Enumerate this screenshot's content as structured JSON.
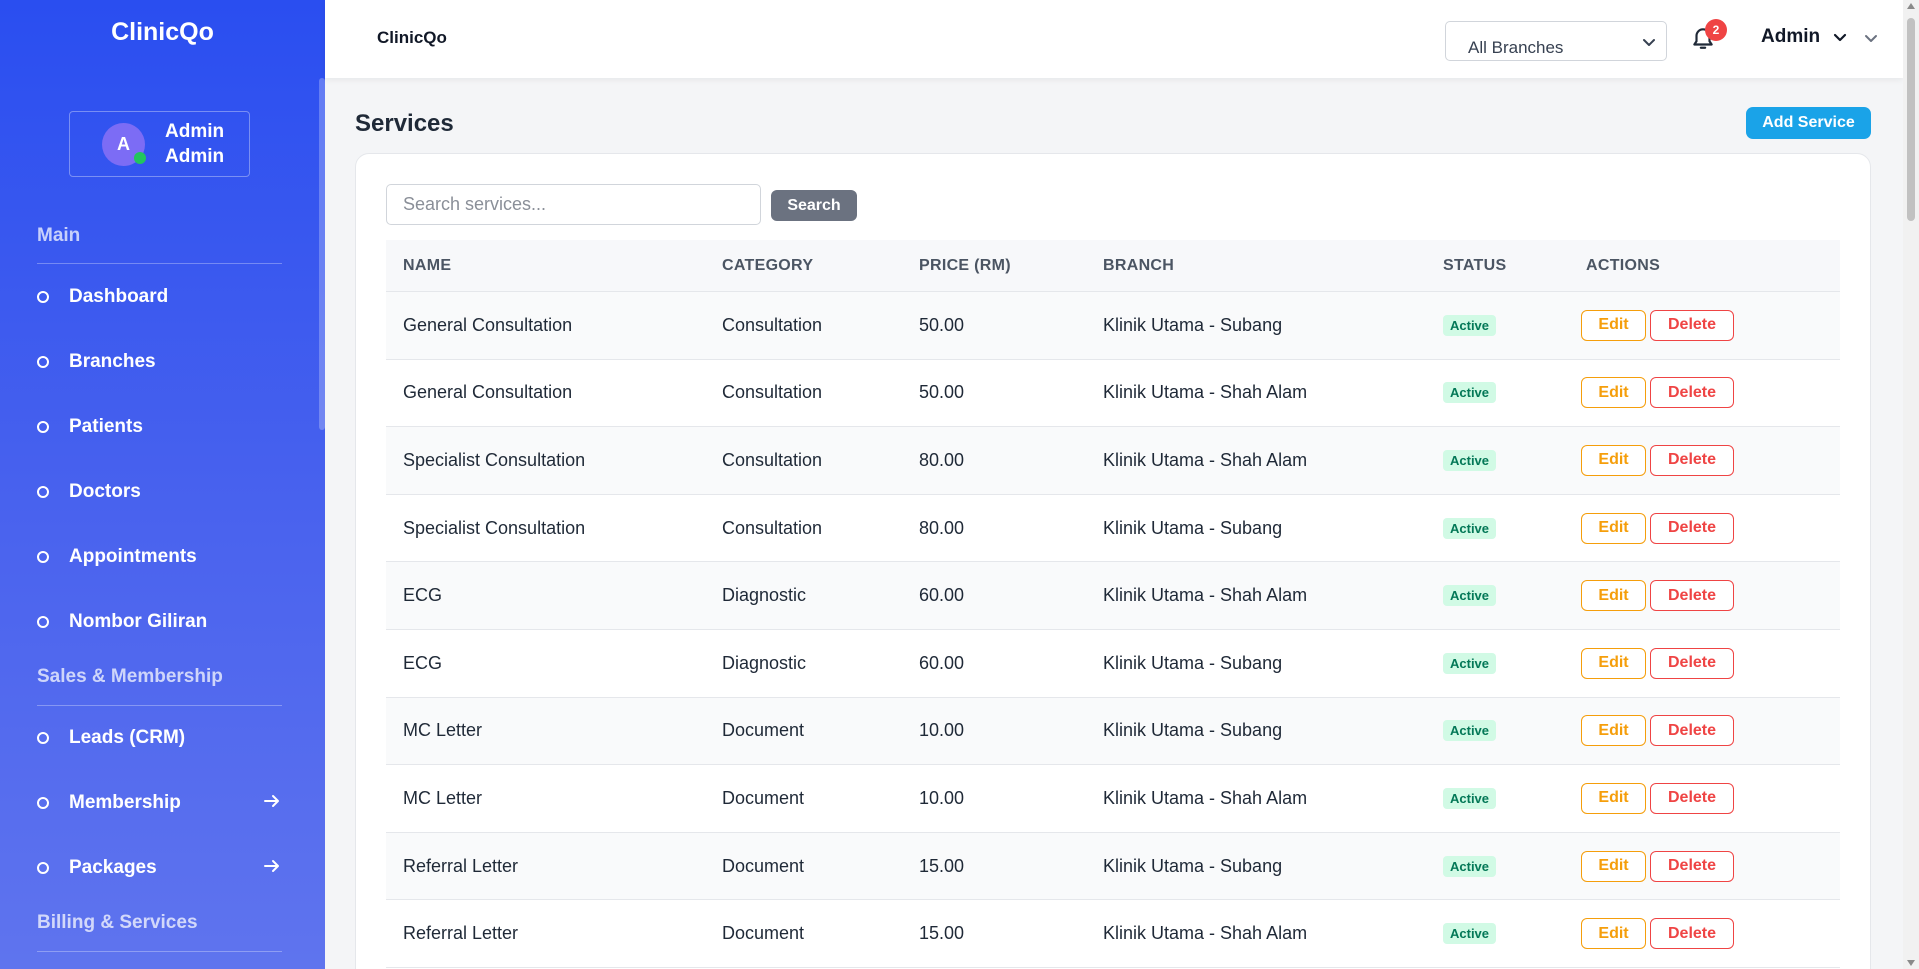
{
  "sidebar": {
    "brand": "ClinicQo",
    "user": {
      "initial": "A",
      "name": "Admin",
      "role": "Admin"
    },
    "sections": {
      "main": "Main",
      "sales": "Sales & Membership",
      "billing": "Billing & Services"
    },
    "items": [
      {
        "label": "Dashboard"
      },
      {
        "label": "Branches"
      },
      {
        "label": "Patients"
      },
      {
        "label": "Doctors"
      },
      {
        "label": "Appointments"
      },
      {
        "label": "Nombor Giliran"
      },
      {
        "label": "Leads (CRM)"
      },
      {
        "label": "Membership"
      },
      {
        "label": "Packages"
      }
    ]
  },
  "topbar": {
    "title": "ClinicQo",
    "branch_select": "All Branches",
    "notification_count": "2",
    "user_menu": "Admin"
  },
  "page": {
    "title": "Services",
    "add_button": "Add Service",
    "search_placeholder": "Search services...",
    "search_button": "Search"
  },
  "table": {
    "columns": [
      "NAME",
      "CATEGORY",
      "PRICE (RM)",
      "BRANCH",
      "STATUS",
      "ACTIONS"
    ],
    "edit_label": "Edit",
    "delete_label": "Delete",
    "rows": [
      {
        "name": "General Consultation",
        "category": "Consultation",
        "price": "50.00",
        "branch": "Klinik Utama - Subang",
        "status": "Active"
      },
      {
        "name": "General Consultation",
        "category": "Consultation",
        "price": "50.00",
        "branch": "Klinik Utama - Shah Alam",
        "status": "Active"
      },
      {
        "name": "Specialist Consultation",
        "category": "Consultation",
        "price": "80.00",
        "branch": "Klinik Utama - Shah Alam",
        "status": "Active"
      },
      {
        "name": "Specialist Consultation",
        "category": "Consultation",
        "price": "80.00",
        "branch": "Klinik Utama - Subang",
        "status": "Active"
      },
      {
        "name": "ECG",
        "category": "Diagnostic",
        "price": "60.00",
        "branch": "Klinik Utama - Shah Alam",
        "status": "Active"
      },
      {
        "name": "ECG",
        "category": "Diagnostic",
        "price": "60.00",
        "branch": "Klinik Utama - Subang",
        "status": "Active"
      },
      {
        "name": "MC Letter",
        "category": "Document",
        "price": "10.00",
        "branch": "Klinik Utama - Subang",
        "status": "Active"
      },
      {
        "name": "MC Letter",
        "category": "Document",
        "price": "10.00",
        "branch": "Klinik Utama - Shah Alam",
        "status": "Active"
      },
      {
        "name": "Referral Letter",
        "category": "Document",
        "price": "15.00",
        "branch": "Klinik Utama - Subang",
        "status": "Active"
      },
      {
        "name": "Referral Letter",
        "category": "Document",
        "price": "15.00",
        "branch": "Klinik Utama - Shah Alam",
        "status": "Active"
      }
    ]
  }
}
